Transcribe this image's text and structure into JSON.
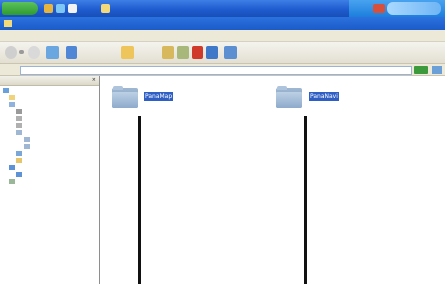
{
  "taskbar": {
    "start_label": "",
    "window_title": "",
    "colors": {
      "bar": "#1f5ccf",
      "start": "#3aa53a",
      "tray": "#2a8ae4"
    }
  },
  "titlebar": {
    "title": ""
  },
  "menubar": {
    "items": [
      "",
      "",
      "",
      "",
      "",
      "",
      ""
    ]
  },
  "toolbar": {
    "search_label": "",
    "folders_label": ""
  },
  "addressbar": {
    "label": "",
    "value": ""
  },
  "left_pane": {
    "header": "",
    "close_glyph": "×",
    "tree": [
      "",
      "",
      "",
      "",
      "",
      "",
      "",
      "",
      "",
      "",
      "",
      "",
      "",
      "",
      ""
    ]
  },
  "content": {
    "folders": [
      {
        "name": "PanaMap",
        "icon": "folder-icon"
      },
      {
        "name": "PanaNavi",
        "icon": "folder-icon"
      }
    ]
  }
}
